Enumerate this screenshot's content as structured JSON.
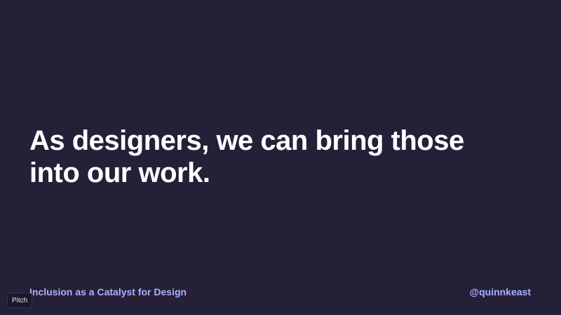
{
  "slide": {
    "headline_lines": [
      "As designers, we can bring those",
      "into our work."
    ],
    "footer_title": "Inclusion as a Catalyst for Design",
    "footer_handle": "@quinnkeast"
  },
  "badge": {
    "label": "Pitch"
  },
  "colors": {
    "background": "#261f38",
    "headline": "#ffffff",
    "footer_accent": "#a8b3ff"
  }
}
